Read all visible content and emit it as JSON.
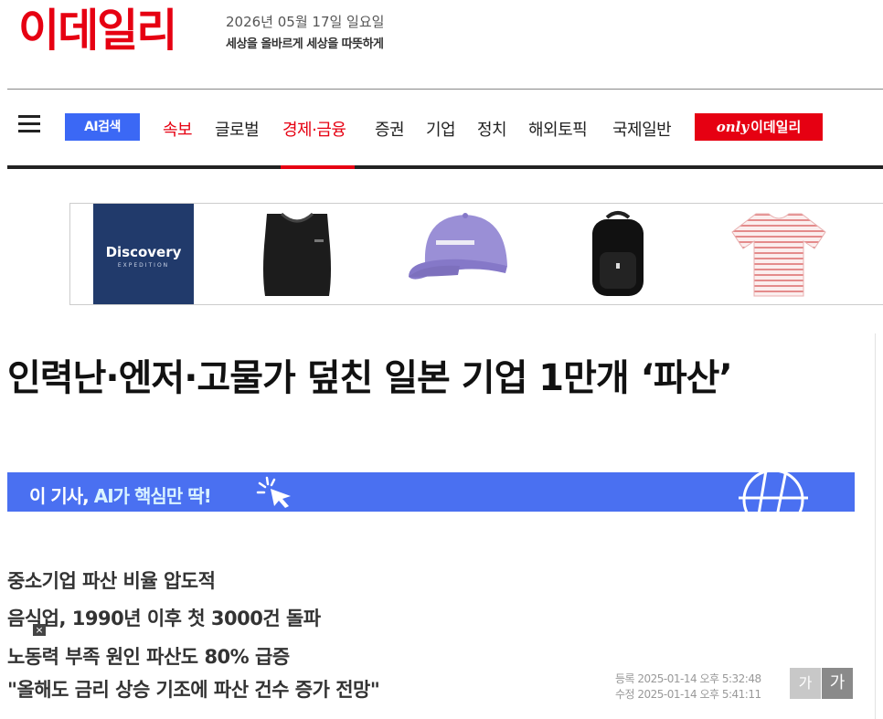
{
  "header": {
    "logo": "이데일리",
    "date": "2026년 05월 17일 일요일",
    "slogan": "세상을 올바르게 세상을 따뜻하게"
  },
  "nav": {
    "ai_search": "AI검색",
    "items": [
      "속보",
      "글로벌",
      "경제·금융",
      "증권",
      "기업",
      "정치",
      "해외토픽",
      "국제일반"
    ],
    "only_badge_word": "only",
    "only_badge_name": "이데일리"
  },
  "ad": {
    "brand_name": "Discovery",
    "brand_sub": "EXPEDITION"
  },
  "article": {
    "headline": "인력난·엔저·고물가 덮친 일본 기업 1만개 ‘파산’",
    "ai_bar_prefix": "이 기사,",
    "ai_bar_highlight": "AI가 핵심만 딱!",
    "summary": [
      "중소기업 파산 비율 압도적",
      "음식업, 1990년 이후 첫 3000건 돌파",
      "노동력 부족 원인 파산도 80% 급증",
      "\"올해도 금리 상승 기조에 파산 건수 증가 전망\""
    ],
    "registered": "등록 2025-01-14 오후 5:32:48",
    "modified": "수정 2025-01-14 오후 5:41:11",
    "font_small": "가",
    "font_large": "가"
  },
  "colors": {
    "brand_red": "#e60012",
    "ai_blue": "#4a70f1"
  }
}
